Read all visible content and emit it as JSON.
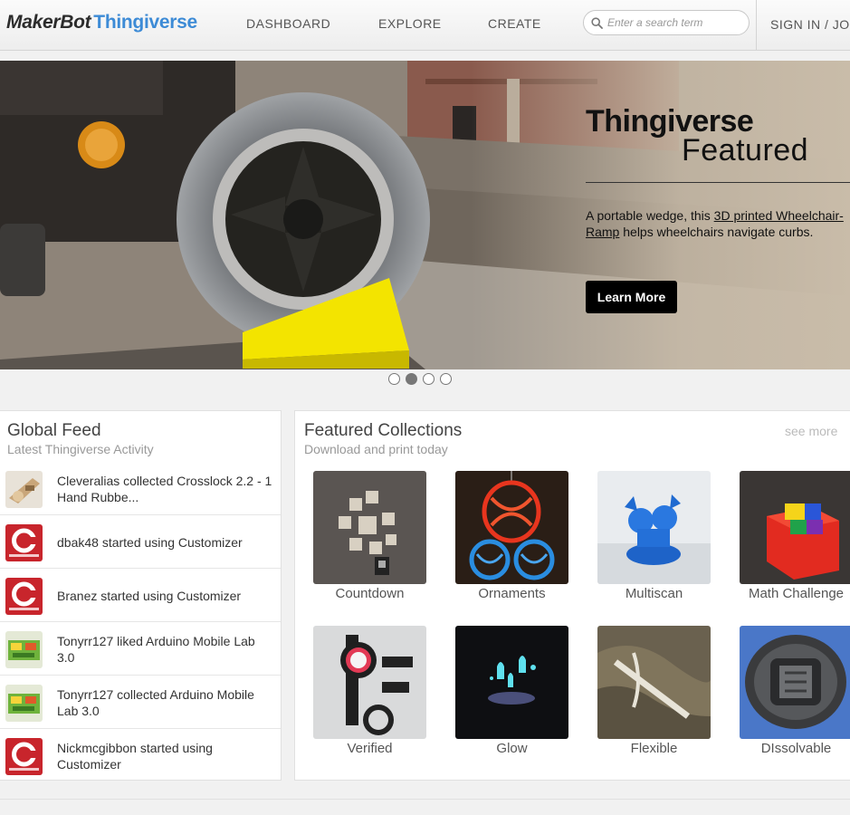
{
  "header": {
    "logo_prefix": "MakerBot",
    "logo_name": "Thingiverse",
    "nav": [
      "DASHBOARD",
      "EXPLORE",
      "CREATE"
    ],
    "search_placeholder": "Enter a search term",
    "signin": "SIGN IN / JOI"
  },
  "hero": {
    "title": "Thingiverse",
    "subtitle": "Featured",
    "desc_before": "A portable wedge, this ",
    "desc_link": "3D printed Wheelchair-Ramp",
    "desc_after": " helps wheelchairs navigate curbs.",
    "button": "Learn More",
    "active_slide": 2,
    "slide_count": 4
  },
  "feed": {
    "title": "Global Feed",
    "subtitle": "Latest Thingiverse Activity",
    "items": [
      {
        "text": "Cleveralias collected Crosslock 2.2 - 1 Hand Rubbe...",
        "thumb": "crosslock"
      },
      {
        "text": "dbak48 started using Customizer",
        "thumb": "customizer"
      },
      {
        "text": "Branez started using Customizer",
        "thumb": "customizer"
      },
      {
        "text": "Tonyrr127 liked Arduino Mobile Lab 3.0",
        "thumb": "arduino"
      },
      {
        "text": "Tonyrr127 collected Arduino Mobile Lab 3.0",
        "thumb": "arduino"
      },
      {
        "text": "Nickmcgibbon started using Customizer",
        "thumb": "customizer"
      }
    ]
  },
  "collections": {
    "title": "Featured Collections",
    "subtitle": "Download and print today",
    "see_more": "see more",
    "items": [
      "Countdown",
      "Ornaments",
      "Multiscan",
      "Math Challenge",
      "Verified",
      "Glow",
      "Flexible",
      "DIssolvable"
    ]
  }
}
